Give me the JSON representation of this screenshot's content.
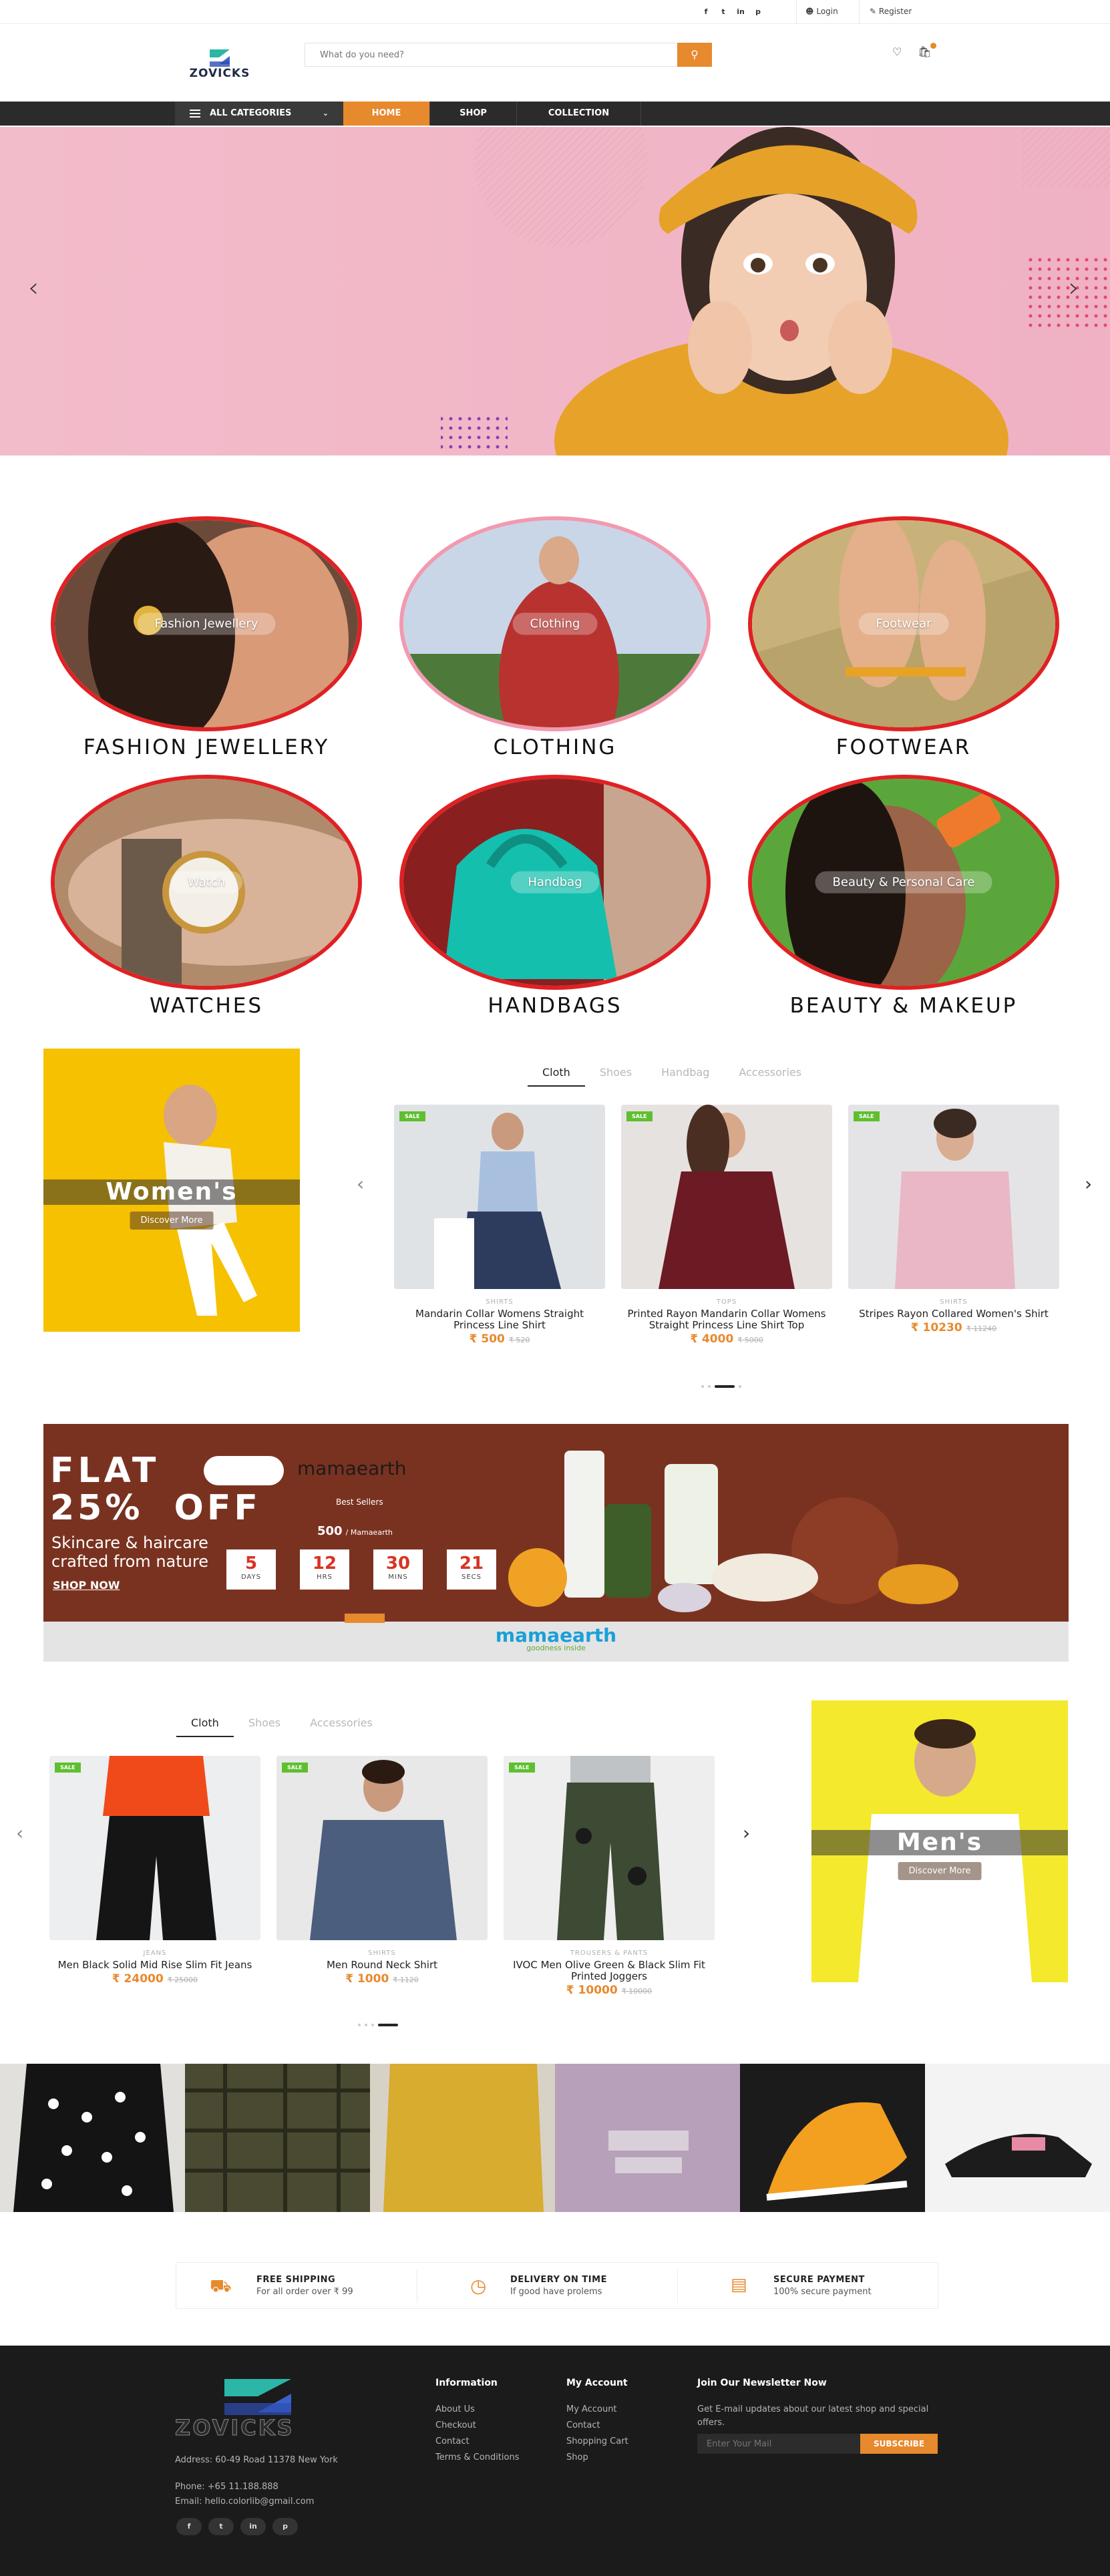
{
  "topbar": {
    "social": [
      "f",
      "t",
      "in",
      "p"
    ],
    "login": "Login",
    "register": "Register"
  },
  "header": {
    "logo": "ZOVICKS",
    "search_placeholder": "What do you need?",
    "search_icon": "search-icon",
    "wishlist_icon": "heart-icon",
    "cart_icon": "bag-icon"
  },
  "nav": {
    "all_categories": "ALL CATEGORIES",
    "items": [
      "HOME",
      "SHOP",
      "COLLECTION"
    ]
  },
  "categories": [
    {
      "label": "Fashion Jewellery",
      "title": "FASHION JEWELLERY"
    },
    {
      "label": "Clothing",
      "title": "CLOTHING"
    },
    {
      "label": "Footwear",
      "title": "FOOTWEAR"
    },
    {
      "label": "Watch",
      "title": "WATCHES"
    },
    {
      "label": "Handbag",
      "title": "HANDBAGS"
    },
    {
      "label": "Beauty & Personal Care",
      "title": "BEAUTY & MAKEUP"
    }
  ],
  "women": {
    "banner_title": "Women's",
    "discover": "Discover More",
    "tabs": [
      "Cloth",
      "Shoes",
      "Handbag",
      "Accessories"
    ],
    "products": [
      {
        "badge": "SALE",
        "category": "SHIRTS",
        "name": "Mandarin Collar Womens Straight Princess Line Shirt",
        "price": "₹ 500",
        "old_price": "₹ 520"
      },
      {
        "badge": "SALE",
        "category": "TOPS",
        "name": "Printed Rayon Mandarin Collar Womens Straight Princess Line Shirt Top",
        "price": "₹ 4000",
        "old_price": "₹ 5000"
      },
      {
        "badge": "SALE",
        "category": "SHIRTS",
        "name": "Stripes Rayon Collared Women's Shirt",
        "price": "₹ 10230",
        "old_price": "₹ 11240"
      }
    ]
  },
  "promo": {
    "line1": "FLAT",
    "line2": "25%  OFF",
    "line3": "Skincare & haircare",
    "line4": "crafted from nature",
    "shop_now": "SHOP NOW",
    "brand": "mamaearth",
    "best_sellers": "Best Sellers",
    "price": "500",
    "price_unit": "/ Mamaearth",
    "countdown": [
      {
        "n": "5",
        "l": "DAYS"
      },
      {
        "n": "12",
        "l": "HRS"
      },
      {
        "n": "30",
        "l": "MINS"
      },
      {
        "n": "21",
        "l": "SECS"
      }
    ],
    "footer_brand": "mamaearth",
    "footer_tag": "goodness inside"
  },
  "men": {
    "banner_title": "Men's",
    "discover": "Discover More",
    "tabs": [
      "Cloth",
      "Shoes",
      "Accessories"
    ],
    "products": [
      {
        "badge": "SALE",
        "category": "JEANS",
        "name": "Men Black Solid Mid Rise Slim Fit Jeans",
        "price": "₹ 24000",
        "old_price": "₹ 25000"
      },
      {
        "badge": "SALE",
        "category": "SHIRTS",
        "name": "Men Round Neck Shirt",
        "price": "₹ 1000",
        "old_price": "₹ 1120"
      },
      {
        "badge": "SALE",
        "category": "TROUSERS & PANTS",
        "name": "IVOC Men Olive Green & Black Slim Fit Printed Joggers",
        "price": "₹ 10000",
        "old_price": "₹ 10000"
      }
    ]
  },
  "services": [
    {
      "title": "FREE SHIPPING",
      "sub": "For all order over ₹ 99",
      "icon": "truck-icon"
    },
    {
      "title": "DELIVERY ON TIME",
      "sub": "If good have prolems",
      "icon": "clock-icon"
    },
    {
      "title": "SECURE PAYMENT",
      "sub": "100% secure payment",
      "icon": "card-icon"
    }
  ],
  "footer": {
    "logo": "ZOVICKS",
    "address": "Address: 60-49 Road 11378 New York",
    "phone": "Phone: +65 11.188.888",
    "email": "Email: hello.colorlib@gmail.com",
    "social": [
      "f",
      "t",
      "in",
      "p"
    ],
    "info_title": "Information",
    "info_links": [
      "About Us",
      "Checkout",
      "Contact",
      "Terms & Conditions"
    ],
    "account_title": "My Account",
    "account_links": [
      "My Account",
      "Contact",
      "Shopping Cart",
      "Shop"
    ],
    "newsletter_title": "Join Our Newsletter Now",
    "newsletter_text": "Get E-mail updates about our latest shop and special offers.",
    "email_placeholder": "Enter Your Mail",
    "subscribe": "SUBSCRIBE"
  },
  "colors": {
    "accent": "#e7892d",
    "dark": "#2b2b2b",
    "sale": "#5fbf2f",
    "footer": "#1b1b1b"
  }
}
